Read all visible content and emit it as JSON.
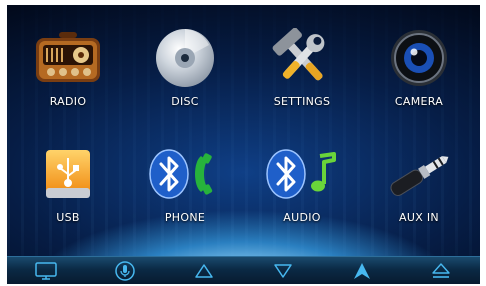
{
  "colors": {
    "accent": "#2f8ed6",
    "background": "#061d46",
    "label": "#ffffff"
  },
  "tiles": [
    {
      "label": "RADIO",
      "icon": "radio-icon"
    },
    {
      "label": "DISC",
      "icon": "disc-icon"
    },
    {
      "label": "SETTINGS",
      "icon": "settings-icon"
    },
    {
      "label": "CAMERA",
      "icon": "camera-icon"
    },
    {
      "label": "USB",
      "icon": "usb-icon"
    },
    {
      "label": "PHONE",
      "icon": "bluetooth-phone-icon"
    },
    {
      "label": "AUDIO",
      "icon": "bluetooth-audio-icon"
    },
    {
      "label": "AUX IN",
      "icon": "aux-jack-icon"
    }
  ],
  "bottom_bar": {
    "icons": [
      "screen-icon",
      "microphone-icon",
      "up-arrow-icon",
      "down-arrow-icon",
      "navigation-icon",
      "eject-icon"
    ]
  }
}
